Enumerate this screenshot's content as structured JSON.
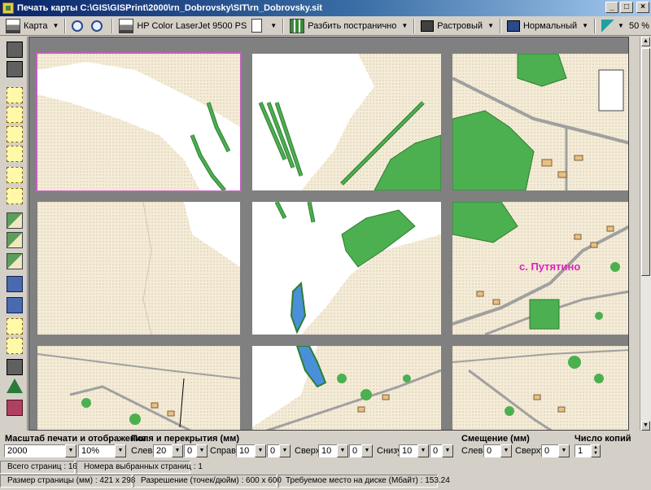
{
  "window": {
    "title": "Печать карты C:\\GIS\\GISPrint\\2000\\rn_Dobrovsky\\SIT\\rn_Dobrovsky.sit",
    "controls": {
      "minimize": "_",
      "maximize": "□",
      "close": "×"
    }
  },
  "toolbar": {
    "map_label": "Карта",
    "printer_label": "HP Color LaserJet 9500 PS",
    "split_label": "Разбить постранично",
    "raster_label": "Растровый",
    "normal_label": "Нормальный",
    "zoom_label": "50 %",
    "icons": [
      "printer-icon",
      "zoom-in-icon",
      "zoom-out-icon",
      "page-orientation-icon",
      "split-pages-icon",
      "raster-icon",
      "normal-mode-icon",
      "pen-icon"
    ]
  },
  "map": {
    "place_label": "с. Путятино",
    "colors": {
      "forest": "#4caf50",
      "forest_edge": "#2e7d32",
      "sand": "#e8dcc0",
      "water": "#4a90d9",
      "road": "#a0a0a0",
      "label": "#e020c0",
      "selected_border": "#c060c0"
    }
  },
  "bottom": {
    "scale_group": {
      "title": "Масштаб печати и отображения",
      "scale_value": "2000",
      "percent_value": "10%"
    },
    "margins_group": {
      "title": "Поля и перекрытия (мм)",
      "left_label": "Слева",
      "left_value": "20",
      "left_overlap": "0",
      "right_label": "Справа",
      "right_value": "10",
      "right_overlap": "0",
      "top_label": "Сверху",
      "top_value": "10",
      "top_overlap": "0",
      "bottom_label": "Снизу",
      "bottom_value": "10",
      "bottom_overlap": "0"
    },
    "offset_group": {
      "title": "Смещение (мм)",
      "left_label": "Слева",
      "left_value": "0",
      "top_label": "Сверху",
      "top_value": "0"
    },
    "copies_group": {
      "title": "Число копий",
      "value": "1"
    }
  },
  "status": {
    "total_pages": "Всего страниц : 16",
    "selected_pages": "Номера выбранных страниц :  1",
    "page_size": "Размер страницы (мм) :  421 x 298",
    "resolution": "Разрешение (точек/дюйм) :  600 x 600",
    "disk_space": "Требуемое место на диске (Мбайт) :  153.24"
  }
}
